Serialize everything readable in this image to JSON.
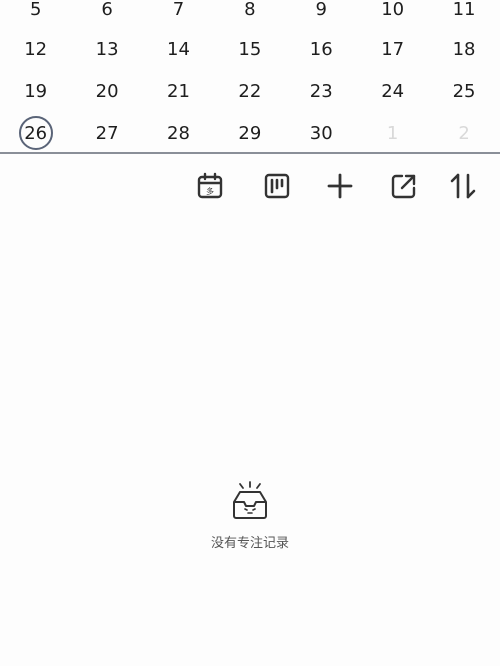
{
  "calendar": {
    "weeks": [
      [
        {
          "d": "5"
        },
        {
          "d": "6"
        },
        {
          "d": "7"
        },
        {
          "d": "8"
        },
        {
          "d": "9"
        },
        {
          "d": "10"
        },
        {
          "d": "11"
        }
      ],
      [
        {
          "d": "12"
        },
        {
          "d": "13"
        },
        {
          "d": "14"
        },
        {
          "d": "15"
        },
        {
          "d": "16"
        },
        {
          "d": "17"
        },
        {
          "d": "18"
        }
      ],
      [
        {
          "d": "19"
        },
        {
          "d": "20"
        },
        {
          "d": "21"
        },
        {
          "d": "22"
        },
        {
          "d": "23"
        },
        {
          "d": "24"
        },
        {
          "d": "25"
        }
      ],
      [
        {
          "d": "26",
          "today": true
        },
        {
          "d": "27"
        },
        {
          "d": "28"
        },
        {
          "d": "29"
        },
        {
          "d": "30"
        },
        {
          "d": "1",
          "other": true
        },
        {
          "d": "2",
          "other": true
        }
      ]
    ],
    "today_ring_color": "#5a6478"
  },
  "toolbar": {
    "calendar_icon_glyph": "多",
    "icons": [
      "calendar-icon",
      "kanban-icon",
      "plus-icon",
      "export-icon",
      "sort-icon"
    ]
  },
  "empty_state": {
    "icon": "empty-inbox-icon",
    "text": "没有专注记录"
  }
}
